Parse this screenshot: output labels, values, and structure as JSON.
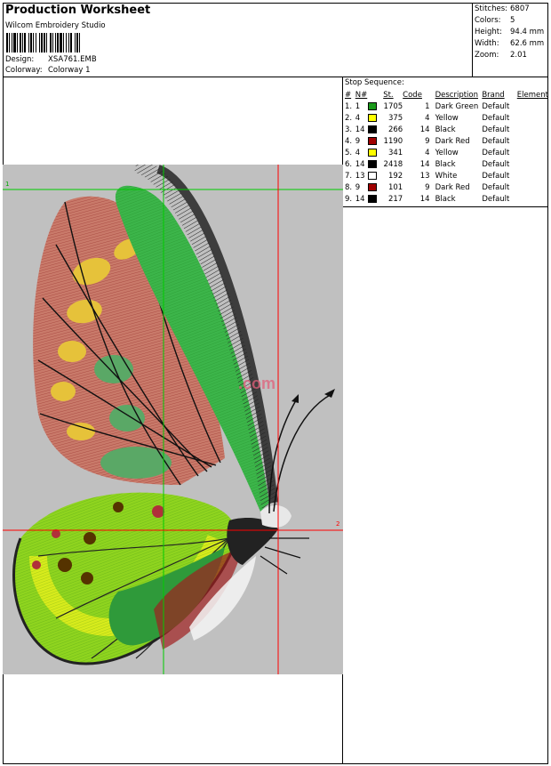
{
  "header": {
    "title": "Production Worksheet",
    "software": "Wilcom  Embroidery Studio",
    "design_label": "Design:",
    "design_value": "XSA761.EMB",
    "colorway_label": "Colorway:",
    "colorway_value": "Colorway 1"
  },
  "stats": {
    "stitches_label": "Stitches:",
    "stitches_value": "6807",
    "colors_label": "Colors:",
    "colors_value": "5",
    "height_label": "Height:",
    "height_value": "94.4 mm",
    "width_label": "Width:",
    "width_value": "62.6 mm",
    "zoom_label": "Zoom:",
    "zoom_value": "2.01"
  },
  "stop_sequence": {
    "title": "Stop Sequence:",
    "headers": {
      "idx": "#",
      "nn": "N#",
      "st": "St.",
      "code": "Code",
      "desc": "Description",
      "brand": "Brand",
      "element": "Element"
    },
    "rows": [
      {
        "idx": "1.",
        "nn": "1",
        "color": "#1a9a1a",
        "st": "1705",
        "code": "1",
        "desc": "Dark Green",
        "brand": "Default"
      },
      {
        "idx": "2.",
        "nn": "4",
        "color": "#ffff00",
        "st": "375",
        "code": "4",
        "desc": "Yellow",
        "brand": "Default"
      },
      {
        "idx": "3.",
        "nn": "14",
        "color": "#000000",
        "st": "266",
        "code": "14",
        "desc": "Black",
        "brand": "Default"
      },
      {
        "idx": "4.",
        "nn": "9",
        "color": "#a00000",
        "st": "1190",
        "code": "9",
        "desc": "Dark Red",
        "brand": "Default"
      },
      {
        "idx": "5.",
        "nn": "4",
        "color": "#ffff00",
        "st": "341",
        "code": "4",
        "desc": "Yellow",
        "brand": "Default"
      },
      {
        "idx": "6.",
        "nn": "14",
        "color": "#000000",
        "st": "2418",
        "code": "14",
        "desc": "Black",
        "brand": "Default"
      },
      {
        "idx": "7.",
        "nn": "13",
        "color": "#ffffff",
        "st": "192",
        "code": "13",
        "desc": "White",
        "brand": "Default"
      },
      {
        "idx": "8.",
        "nn": "9",
        "color": "#a00000",
        "st": "101",
        "code": "9",
        "desc": "Dark Red",
        "brand": "Default"
      },
      {
        "idx": "9.",
        "nn": "14",
        "color": "#000000",
        "st": "217",
        "code": "14",
        "desc": "Black",
        "brand": "Default"
      }
    ]
  },
  "design_view": {
    "background_color": "#c0c0c0",
    "marker_1": "1",
    "marker_2": "2",
    "guide_green": "#00cc00",
    "guide_red": "#ff0000"
  }
}
